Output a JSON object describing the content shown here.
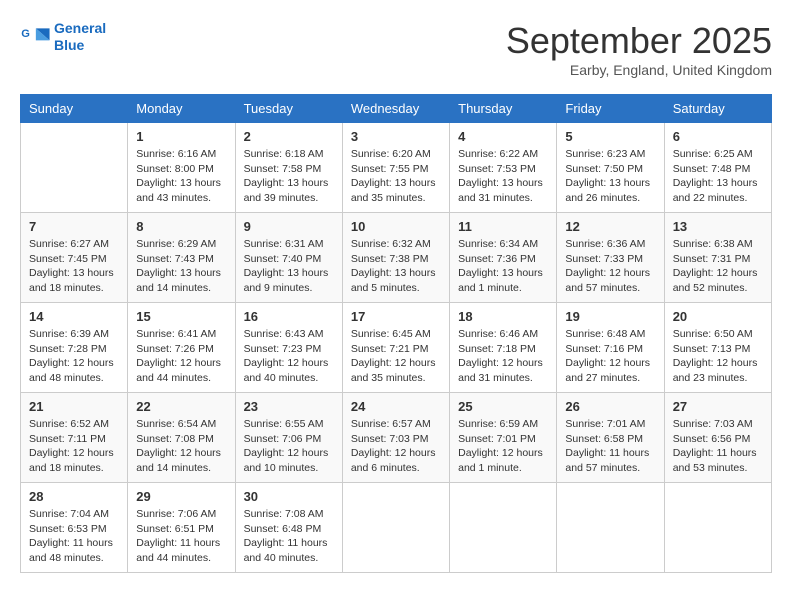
{
  "header": {
    "logo_line1": "General",
    "logo_line2": "Blue",
    "month": "September 2025",
    "location": "Earby, England, United Kingdom"
  },
  "weekdays": [
    "Sunday",
    "Monday",
    "Tuesday",
    "Wednesday",
    "Thursday",
    "Friday",
    "Saturday"
  ],
  "weeks": [
    [
      {
        "day": "",
        "info": ""
      },
      {
        "day": "1",
        "info": "Sunrise: 6:16 AM\nSunset: 8:00 PM\nDaylight: 13 hours\nand 43 minutes."
      },
      {
        "day": "2",
        "info": "Sunrise: 6:18 AM\nSunset: 7:58 PM\nDaylight: 13 hours\nand 39 minutes."
      },
      {
        "day": "3",
        "info": "Sunrise: 6:20 AM\nSunset: 7:55 PM\nDaylight: 13 hours\nand 35 minutes."
      },
      {
        "day": "4",
        "info": "Sunrise: 6:22 AM\nSunset: 7:53 PM\nDaylight: 13 hours\nand 31 minutes."
      },
      {
        "day": "5",
        "info": "Sunrise: 6:23 AM\nSunset: 7:50 PM\nDaylight: 13 hours\nand 26 minutes."
      },
      {
        "day": "6",
        "info": "Sunrise: 6:25 AM\nSunset: 7:48 PM\nDaylight: 13 hours\nand 22 minutes."
      }
    ],
    [
      {
        "day": "7",
        "info": "Sunrise: 6:27 AM\nSunset: 7:45 PM\nDaylight: 13 hours\nand 18 minutes."
      },
      {
        "day": "8",
        "info": "Sunrise: 6:29 AM\nSunset: 7:43 PM\nDaylight: 13 hours\nand 14 minutes."
      },
      {
        "day": "9",
        "info": "Sunrise: 6:31 AM\nSunset: 7:40 PM\nDaylight: 13 hours\nand 9 minutes."
      },
      {
        "day": "10",
        "info": "Sunrise: 6:32 AM\nSunset: 7:38 PM\nDaylight: 13 hours\nand 5 minutes."
      },
      {
        "day": "11",
        "info": "Sunrise: 6:34 AM\nSunset: 7:36 PM\nDaylight: 13 hours\nand 1 minute."
      },
      {
        "day": "12",
        "info": "Sunrise: 6:36 AM\nSunset: 7:33 PM\nDaylight: 12 hours\nand 57 minutes."
      },
      {
        "day": "13",
        "info": "Sunrise: 6:38 AM\nSunset: 7:31 PM\nDaylight: 12 hours\nand 52 minutes."
      }
    ],
    [
      {
        "day": "14",
        "info": "Sunrise: 6:39 AM\nSunset: 7:28 PM\nDaylight: 12 hours\nand 48 minutes."
      },
      {
        "day": "15",
        "info": "Sunrise: 6:41 AM\nSunset: 7:26 PM\nDaylight: 12 hours\nand 44 minutes."
      },
      {
        "day": "16",
        "info": "Sunrise: 6:43 AM\nSunset: 7:23 PM\nDaylight: 12 hours\nand 40 minutes."
      },
      {
        "day": "17",
        "info": "Sunrise: 6:45 AM\nSunset: 7:21 PM\nDaylight: 12 hours\nand 35 minutes."
      },
      {
        "day": "18",
        "info": "Sunrise: 6:46 AM\nSunset: 7:18 PM\nDaylight: 12 hours\nand 31 minutes."
      },
      {
        "day": "19",
        "info": "Sunrise: 6:48 AM\nSunset: 7:16 PM\nDaylight: 12 hours\nand 27 minutes."
      },
      {
        "day": "20",
        "info": "Sunrise: 6:50 AM\nSunset: 7:13 PM\nDaylight: 12 hours\nand 23 minutes."
      }
    ],
    [
      {
        "day": "21",
        "info": "Sunrise: 6:52 AM\nSunset: 7:11 PM\nDaylight: 12 hours\nand 18 minutes."
      },
      {
        "day": "22",
        "info": "Sunrise: 6:54 AM\nSunset: 7:08 PM\nDaylight: 12 hours\nand 14 minutes."
      },
      {
        "day": "23",
        "info": "Sunrise: 6:55 AM\nSunset: 7:06 PM\nDaylight: 12 hours\nand 10 minutes."
      },
      {
        "day": "24",
        "info": "Sunrise: 6:57 AM\nSunset: 7:03 PM\nDaylight: 12 hours\nand 6 minutes."
      },
      {
        "day": "25",
        "info": "Sunrise: 6:59 AM\nSunset: 7:01 PM\nDaylight: 12 hours\nand 1 minute."
      },
      {
        "day": "26",
        "info": "Sunrise: 7:01 AM\nSunset: 6:58 PM\nDaylight: 11 hours\nand 57 minutes."
      },
      {
        "day": "27",
        "info": "Sunrise: 7:03 AM\nSunset: 6:56 PM\nDaylight: 11 hours\nand 53 minutes."
      }
    ],
    [
      {
        "day": "28",
        "info": "Sunrise: 7:04 AM\nSunset: 6:53 PM\nDaylight: 11 hours\nand 48 minutes."
      },
      {
        "day": "29",
        "info": "Sunrise: 7:06 AM\nSunset: 6:51 PM\nDaylight: 11 hours\nand 44 minutes."
      },
      {
        "day": "30",
        "info": "Sunrise: 7:08 AM\nSunset: 6:48 PM\nDaylight: 11 hours\nand 40 minutes."
      },
      {
        "day": "",
        "info": ""
      },
      {
        "day": "",
        "info": ""
      },
      {
        "day": "",
        "info": ""
      },
      {
        "day": "",
        "info": ""
      }
    ]
  ]
}
